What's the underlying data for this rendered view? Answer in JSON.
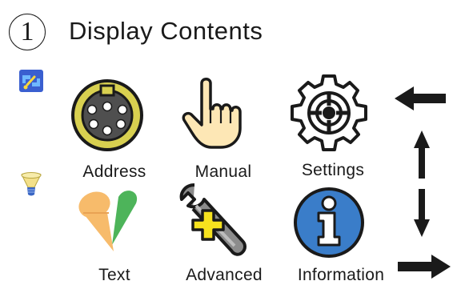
{
  "header": {
    "step_number": "1",
    "title": "Display Contents"
  },
  "menu_items": [
    {
      "id": "address",
      "label": "Address",
      "icon": "dmx-connector-icon"
    },
    {
      "id": "manual",
      "label": "Manual",
      "icon": "hand-pointer-icon"
    },
    {
      "id": "settings",
      "label": "Settings",
      "icon": "gear-icon"
    },
    {
      "id": "text",
      "label": "Text",
      "icon": "ice-cream-icon"
    },
    {
      "id": "advanced",
      "label": "Advanced",
      "icon": "wrench-plus-icon"
    },
    {
      "id": "information",
      "label": "Information",
      "icon": "info-icon"
    }
  ],
  "side_icons": [
    "blue-link-icon",
    "bulb-icon"
  ],
  "nav_arrows": [
    "back-arrow-icon",
    "up-arrow-icon",
    "down-arrow-icon",
    "enter-arrow-icon"
  ],
  "colors": {
    "text": "#1a1a1a",
    "dmx_yellow": "#d8d050",
    "hand_skin": "#fde7b5",
    "ice_cream_orange": "#f7bb6b",
    "ice_cream_green": "#4db45a",
    "wrench_gray": "#8c8c8c",
    "plus_yellow": "#f6e21e",
    "info_blue": "#3a7dc9"
  }
}
